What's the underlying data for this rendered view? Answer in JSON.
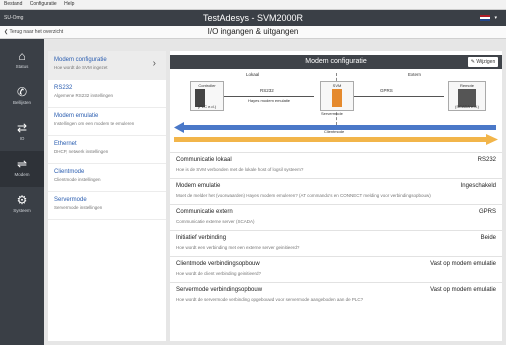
{
  "menu": [
    "Bestand",
    "Configuratie",
    "Help"
  ],
  "titlebar": {
    "logo": "SU-Omg",
    "title": "TestAdesys - SVM2000R"
  },
  "subbar": {
    "back": "Terug naar het overzicht",
    "page": "I/O ingangen & uitgangen"
  },
  "nav": [
    {
      "label": "Status",
      "icon": "home-icon",
      "glyph": "⌂"
    },
    {
      "label": "Bellijsten",
      "icon": "phone-icon",
      "glyph": "✆"
    },
    {
      "label": "IO",
      "icon": "io-arrows-icon",
      "glyph": "⇄"
    },
    {
      "label": "Modem",
      "icon": "shuffle-icon",
      "glyph": "⇌"
    },
    {
      "label": "Systeem",
      "icon": "gear-icon",
      "glyph": "⚙"
    }
  ],
  "side": [
    {
      "title": "Modem configuratie",
      "sub": "Hoe wordt de SVM ingezet",
      "chev": "›"
    },
    {
      "title": "RS232",
      "sub": "Algemene RS232 instellingen"
    },
    {
      "title": "Modem emulatie",
      "sub": "Instellingen om een modem te emuleren"
    },
    {
      "title": "Ethernet",
      "sub": "DHCP, netwerk instellingen"
    },
    {
      "title": "Clientmode",
      "sub": "Clientmode instellingen"
    },
    {
      "title": "Servermode",
      "sub": "Servermode instellingen"
    }
  ],
  "main": {
    "title": "Modem configuratie",
    "wijzig": "✎ Wijzigen",
    "diagram": {
      "lokaal": "Lokaal",
      "extern": "Extern",
      "controller": "Controller",
      "plc": "(PLC e.d.)",
      "rs232": "RS232",
      "hayes": "Hayes modem emulatie",
      "svm": "SVM",
      "servermode": "Servermode",
      "gprs": "GPRS",
      "remote": "Remote",
      "scada": "(SCADA e.d.)",
      "clientmode": "Clientmode"
    },
    "rows": [
      {
        "title": "Communicatie lokaal",
        "value": "RS232",
        "sub": "Hoe is de SVM verbonden met de lokale host of logsil systeem?"
      },
      {
        "title": "Modem emulatie",
        "value": "Ingeschakeld",
        "sub": "Moet de melder het (voorwaarden) Hayes modem emuleren? (AT commando's en CONNECT melding voor verbindingsopbouw)"
      },
      {
        "title": "Communicatie extern",
        "value": "GPRS",
        "sub": "Communicatie externe server (SCADA)"
      },
      {
        "title": "Initiatief verbinding",
        "value": "Beide",
        "sub": "Hoe wordt een verbinding met een externe server geinitieerd?"
      },
      {
        "title": "Clientmode verbindingsopbouw",
        "value": "Vast op modem emulatie",
        "sub": "Hoe wordt de client verbinding geinitieerd?"
      },
      {
        "title": "Servermode verbindingsopbouw",
        "value": "Vast op modem emulatie",
        "sub": "Hoe wordt de servermode verbinding opgebouwd voor servermode aangeboden aan de PLC?"
      }
    ]
  },
  "colors": {
    "dark": "#3a3f46",
    "blue_arrow": "#4a78c8",
    "orange_arrow": "#f2b54a",
    "link": "#2a5db0"
  }
}
